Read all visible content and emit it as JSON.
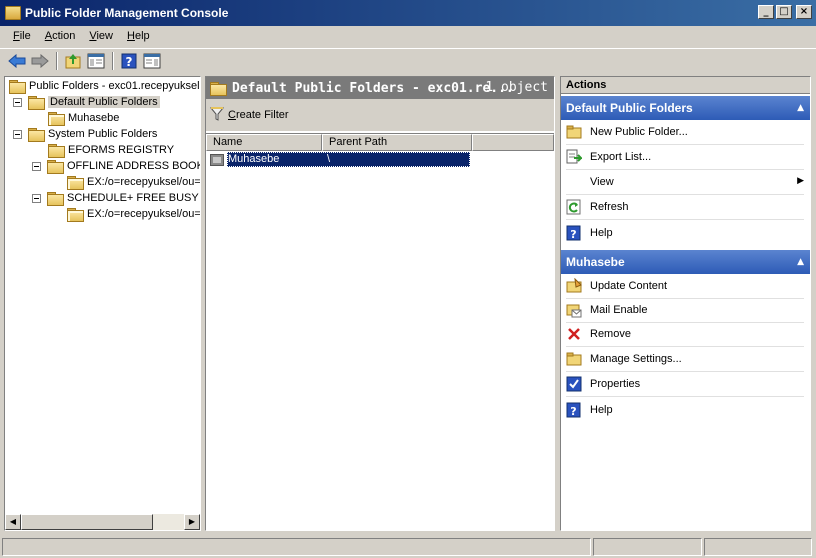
{
  "window": {
    "title": "Public Folder Management Console",
    "buttons": [
      "_",
      "□",
      "×"
    ]
  },
  "menu": [
    {
      "label": "File",
      "accel": "F",
      "rest": "ile"
    },
    {
      "label": "Action",
      "accel": "A",
      "rest": "ction"
    },
    {
      "label": "View",
      "accel": "V",
      "rest": "iew"
    },
    {
      "label": "Help",
      "accel": "H",
      "rest": "elp"
    }
  ],
  "toolbar": {
    "icons": [
      "back-arrow-icon",
      "forward-arrow-icon",
      "up-folder-icon",
      "show-hide-tree-icon",
      "help-icon",
      "show-hide-action-pane-icon"
    ]
  },
  "tree": {
    "root": "Public Folders - exc01.recepyuksel.",
    "default_public_folders": "Default Public Folders",
    "muhasebe": "Muhasebe",
    "system_public_folders": "System Public Folders",
    "eforms_registry": "EFORMS REGISTRY",
    "offline_address_book": "OFFLINE ADDRESS BOOK",
    "oab_child": "EX:/o=recepyuksel/ou=",
    "schedule_free_busy": "SCHEDULE+ FREE BUSY",
    "sfb_child": "EX:/o=recepyuksel/ou="
  },
  "result_pane": {
    "title": "Default Public Folders - exc01.re...",
    "count": "1 object",
    "create_filter": {
      "accel": "C",
      "rest": "reate Filter"
    },
    "columns": [
      "Name",
      "Parent Path"
    ],
    "rows": [
      {
        "name": "Muhasebe",
        "parent_path": "\\"
      }
    ]
  },
  "actions": {
    "title": "Actions",
    "section1": {
      "title": "Default Public Folders",
      "items": [
        {
          "label": "New Public Folder...",
          "icon": "new-folder-icon"
        },
        {
          "label": "Export List...",
          "icon": "export-list-icon"
        },
        {
          "label": "View",
          "icon": "none",
          "submenu": true
        },
        {
          "label": "Refresh",
          "icon": "refresh-icon"
        },
        {
          "label": "Help",
          "icon": "help-icon"
        }
      ]
    },
    "section2": {
      "title": "Muhasebe",
      "items": [
        {
          "label": "Update Content",
          "icon": "update-content-icon"
        },
        {
          "label": "Mail Enable",
          "icon": "mail-enable-icon"
        },
        {
          "label": "Remove",
          "icon": "remove-icon"
        },
        {
          "label": "Manage Settings...",
          "icon": "manage-settings-icon"
        },
        {
          "label": "Properties",
          "icon": "properties-icon"
        },
        {
          "label": "Help",
          "icon": "help-icon"
        }
      ]
    }
  },
  "colors": {
    "titlebar_start": "#0a246a",
    "titlebar_end": "#3a6ea5",
    "section_header": "#2d5bb6",
    "selection": "#0a246a",
    "result_header": "#7a7a7a"
  }
}
